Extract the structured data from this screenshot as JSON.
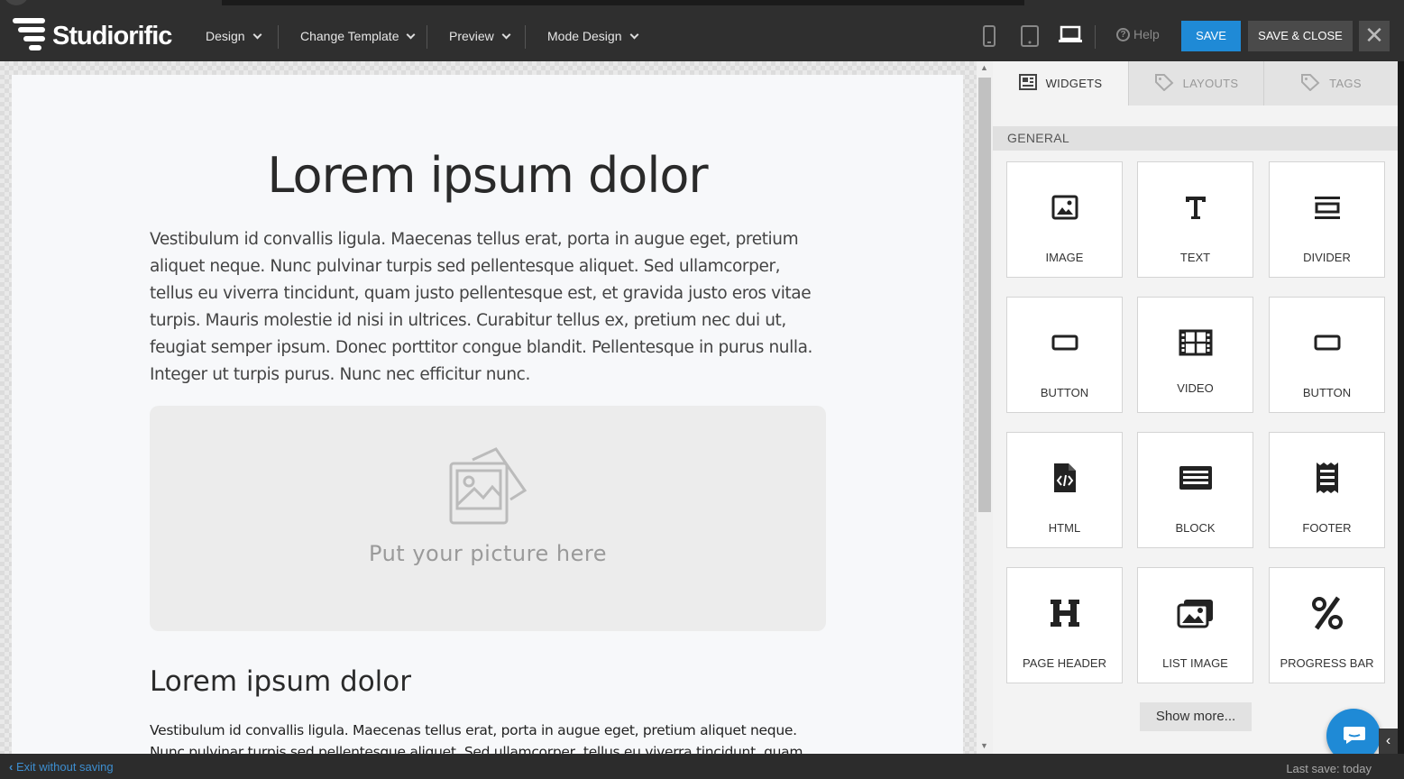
{
  "app": {
    "name": "Studiorific"
  },
  "menu": [
    {
      "label": "Design"
    },
    {
      "label": "Change Template"
    },
    {
      "label": "Preview"
    },
    {
      "label": "Mode Design"
    }
  ],
  "toolbar": {
    "help_label": "Help",
    "save_label": "SAVE",
    "save_close_label": "SAVE & CLOSE",
    "close_label": "✕"
  },
  "canvas": {
    "heading": "Lorem ipsum dolor",
    "paragraph": "Vestibulum id convallis ligula. Maecenas tellus erat, porta in augue eget, pretium aliquet neque. Nunc pulvinar turpis sed pellentesque aliquet. Sed ullamcorper, tellus eu viverra tincidunt, quam justo pellentesque est, et gravida justo eros vitae turpis. Mauris molestie id nisi in ultrices. Curabitur tellus ex, pretium nec dui ut, feugiat semper ipsum. Donec porttitor congue blandit. Pellentesque in purus nulla. Integer ut turpis purus. Nunc nec efficitur nunc.",
    "picture_placeholder": "Put your picture here",
    "subheading": "Lorem ipsum dolor",
    "paragraph2": "Vestibulum id convallis ligula. Maecenas tellus erat, porta in augue eget, pretium aliquet neque. Nunc pulvinar turpis sed pellentesque aliquet. Sed ullamcorper, tellus eu viverra tincidunt, quam justo"
  },
  "panel": {
    "tabs": [
      {
        "label": "WIDGETS",
        "icon": "widgets-icon"
      },
      {
        "label": "LAYOUTS",
        "icon": "tag-icon"
      },
      {
        "label": "TAGS",
        "icon": "tag-icon"
      }
    ],
    "group": "GENERAL",
    "widgets": [
      {
        "label": "IMAGE",
        "icon": "image-icon"
      },
      {
        "label": "TEXT",
        "icon": "text-icon"
      },
      {
        "label": "DIVIDER",
        "icon": "divider-icon"
      },
      {
        "label": "BUTTON",
        "icon": "button-icon"
      },
      {
        "label": "VIDEO",
        "icon": "film-icon"
      },
      {
        "label": "BUTTON",
        "icon": "button-icon"
      },
      {
        "label": "HTML",
        "icon": "code-file-icon"
      },
      {
        "label": "BLOCK",
        "icon": "block-icon"
      },
      {
        "label": "FOOTER",
        "icon": "receipt-icon"
      },
      {
        "label": "PAGE HEADER",
        "icon": "heading-icon"
      },
      {
        "label": "LIST IMAGE",
        "icon": "images-icon"
      },
      {
        "label": "PROGRESS BAR",
        "icon": "percent-icon"
      }
    ],
    "show_more": "Show more..."
  },
  "footer": {
    "exit_label": "Exit without saving",
    "last_save": "Last save: today"
  },
  "colors": {
    "accent": "#1f8ad6",
    "topbar": "#2f2f2f"
  }
}
